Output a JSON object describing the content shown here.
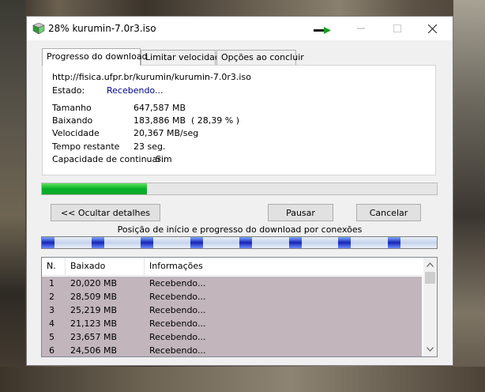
{
  "window": {
    "title": "28% kurumin-7.0r3.iso"
  },
  "tabs": [
    {
      "label": "Progresso do download"
    },
    {
      "label": "Limitar velocidade"
    },
    {
      "label": "Opções ao concluir"
    }
  ],
  "details": {
    "url": "http://fisica.ufpr.br/kurumin/kurumin-7.0r3.iso",
    "estado_label": "Estado:",
    "estado_value": "Recebendo...",
    "fields": [
      {
        "label": "Tamanho",
        "value": "647,587 MB"
      },
      {
        "label": "Baixando",
        "value": "183,886 MB  ( 28,39 % )"
      },
      {
        "label": "Velocidade",
        "value": "20,367 MB/seg"
      },
      {
        "label": "Tempo restante",
        "value": "23 seg."
      },
      {
        "label": "Capacidade de continuar",
        "value": "Sim"
      }
    ]
  },
  "progress": {
    "percent": 26.6
  },
  "buttons": {
    "details": "<< Ocultar detalhes",
    "pause": "Pausar",
    "cancel": "Cancelar"
  },
  "connections": {
    "caption": "Posição de início e progresso do download por conexões",
    "segments": [
      0,
      12.5,
      25,
      37.5,
      50,
      62.5,
      75,
      87.5
    ]
  },
  "list": {
    "headers": {
      "n": "N.",
      "baixado": "Baixado",
      "info": "Informações"
    },
    "rows": [
      {
        "n": "1",
        "baixado": "20,020  MB",
        "info": "Recebendo..."
      },
      {
        "n": "2",
        "baixado": "28,509  MB",
        "info": "Recebendo..."
      },
      {
        "n": "3",
        "baixado": "25,219  MB",
        "info": "Recebendo..."
      },
      {
        "n": "4",
        "baixado": "21,123  MB",
        "info": "Recebendo..."
      },
      {
        "n": "5",
        "baixado": "23,657  MB",
        "info": "Recebendo..."
      },
      {
        "n": "6",
        "baixado": "24,506  MB",
        "info": "Recebendo..."
      }
    ]
  },
  "icons": {
    "app": "download-manager-icon",
    "arrow": "green-arrow-icon",
    "minimize": "minimize-icon",
    "maximize": "maximize-icon",
    "close": "close-icon"
  }
}
